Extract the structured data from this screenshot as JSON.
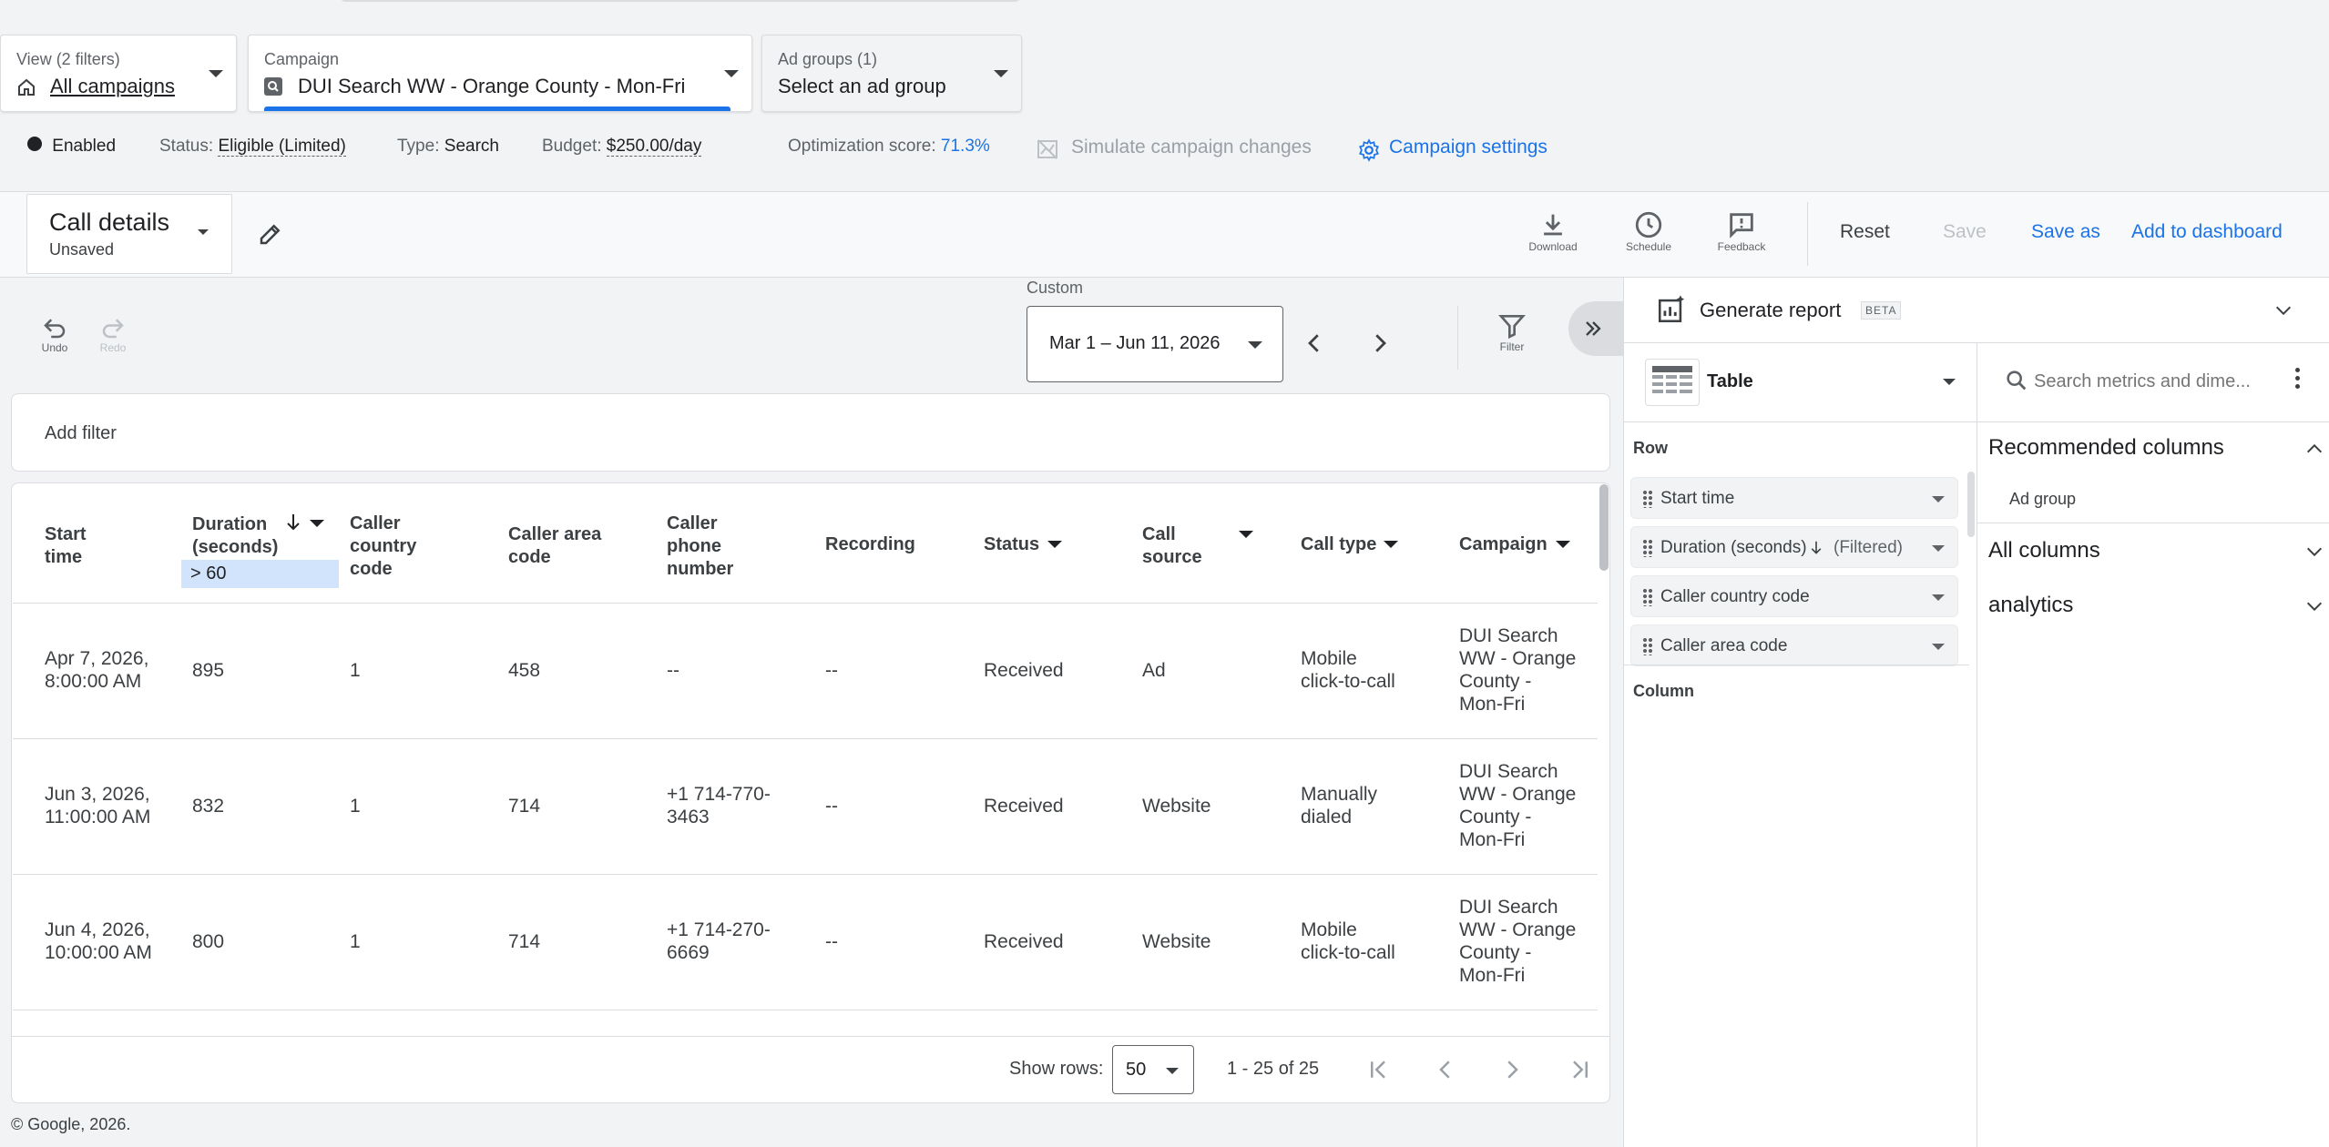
{
  "view": {
    "label": "View (2 filters)",
    "value": "All campaigns"
  },
  "campaign": {
    "label": "Campaign",
    "value": "DUI Search WW - Orange County - Mon-Fri"
  },
  "adgroups": {
    "label": "Ad groups (1)",
    "value": "Select an ad group"
  },
  "status_bar": {
    "enabled": "Enabled",
    "status_label": "Status:",
    "status_value": "Eligible (Limited)",
    "type_label": "Type:",
    "type_value": "Search",
    "budget_label": "Budget:",
    "budget_value": "$250.00/day",
    "opt_label": "Optimization score:",
    "opt_value": "71.3%",
    "simulate": "Simulate campaign changes",
    "settings": "Campaign settings"
  },
  "report": {
    "name": "Call details",
    "state": "Unsaved"
  },
  "toolbar": {
    "download": "Download",
    "schedule": "Schedule",
    "feedback": "Feedback",
    "reset": "Reset",
    "save": "Save",
    "save_as": "Save as",
    "add_dashboard": "Add to dashboard"
  },
  "edit": {
    "undo": "Undo",
    "redo": "Redo",
    "filter": "Filter"
  },
  "date": {
    "label": "Custom",
    "value": "Mar 1 – Jun 11, 2026"
  },
  "filter_bar": {
    "placeholder": "Add filter"
  },
  "table": {
    "headers": {
      "start_time": "Start time",
      "duration": "Duration (seconds)",
      "duration_filter": "> 60",
      "country": "Caller country code",
      "area": "Caller area code",
      "phone": "Caller phone number",
      "recording": "Recording",
      "status": "Status",
      "source": "Call source",
      "type": "Call type",
      "campaign": "Campaign"
    },
    "rows": [
      {
        "start": "Apr 7, 2026, 8:00:00 AM",
        "duration": "895",
        "country": "1",
        "area": "458",
        "phone": "--",
        "recording": "--",
        "status": "Received",
        "source": "Ad",
        "type": "Mobile click-to-call",
        "campaign": "DUI Search WW - Orange County - Mon-Fri"
      },
      {
        "start": "Jun 3, 2026, 11:00:00 AM",
        "duration": "832",
        "country": "1",
        "area": "714",
        "phone": "+1 714-770-3463",
        "recording": "--",
        "status": "Received",
        "source": "Website",
        "type": "Manually dialed",
        "campaign": "DUI Search WW - Orange County - Mon-Fri"
      },
      {
        "start": "Jun 4, 2026, 10:00:00 AM",
        "duration": "800",
        "country": "1",
        "area": "714",
        "phone": "+1 714-270-6669",
        "recording": "--",
        "status": "Received",
        "source": "Website",
        "type": "Mobile click-to-call",
        "campaign": "DUI Search WW - Orange County - Mon-Fri"
      }
    ]
  },
  "pagination": {
    "show_rows_label": "Show rows:",
    "rows_value": "50",
    "range": "1 - 25 of 25"
  },
  "footer": {
    "copyright": "© Google, 2026."
  },
  "panel": {
    "generate": "Generate report",
    "beta": "BETA",
    "viz": "Table",
    "row_label": "Row",
    "row_chips": [
      "Start time",
      "Duration (seconds)",
      "Caller country code",
      "Caller area code"
    ],
    "duration_filtered": "(Filtered)",
    "column_label": "Column",
    "search_placeholder": "Search metrics and dime...",
    "recommended": "Recommended columns",
    "recommended_item": "Ad group",
    "all_columns": "All columns",
    "analytics": "analytics"
  },
  "colors": {
    "accent": "#1a73e8",
    "filter_highlight": "#d2e3fc"
  }
}
